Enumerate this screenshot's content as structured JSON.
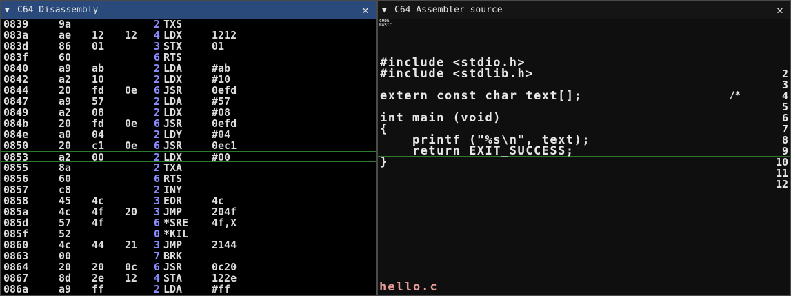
{
  "left_window": {
    "title": "C64 Disassembly",
    "collapse_glyph": "▼",
    "close_glyph": "✕",
    "rows": [
      {
        "addr": "0839",
        "b1": "9a",
        "b2": "",
        "b3": "",
        "cyc": "2",
        "mn": "TXS",
        "op": ""
      },
      {
        "addr": "083a",
        "b1": "ae",
        "b2": "12",
        "b3": "12",
        "cyc": "4",
        "mn": "LDX",
        "op": "1212"
      },
      {
        "addr": "083d",
        "b1": "86",
        "b2": "01",
        "b3": "",
        "cyc": "3",
        "mn": "STX",
        "op": "01"
      },
      {
        "addr": "083f",
        "b1": "60",
        "b2": "",
        "b3": "",
        "cyc": "6",
        "mn": "RTS",
        "op": ""
      },
      {
        "addr": "0840",
        "b1": "a9",
        "b2": "ab",
        "b3": "",
        "cyc": "2",
        "mn": "LDA",
        "op": "#ab"
      },
      {
        "addr": "0842",
        "b1": "a2",
        "b2": "10",
        "b3": "",
        "cyc": "2",
        "mn": "LDX",
        "op": "#10"
      },
      {
        "addr": "0844",
        "b1": "20",
        "b2": "fd",
        "b3": "0e",
        "cyc": "6",
        "mn": "JSR",
        "op": "0efd"
      },
      {
        "addr": "0847",
        "b1": "a9",
        "b2": "57",
        "b3": "",
        "cyc": "2",
        "mn": "LDA",
        "op": "#57"
      },
      {
        "addr": "0849",
        "b1": "a2",
        "b2": "08",
        "b3": "",
        "cyc": "2",
        "mn": "LDX",
        "op": "#08"
      },
      {
        "addr": "084b",
        "b1": "20",
        "b2": "fd",
        "b3": "0e",
        "cyc": "6",
        "mn": "JSR",
        "op": "0efd"
      },
      {
        "addr": "084e",
        "b1": "a0",
        "b2": "04",
        "b3": "",
        "cyc": "2",
        "mn": "LDY",
        "op": "#04"
      },
      {
        "addr": "0850",
        "b1": "20",
        "b2": "c1",
        "b3": "0e",
        "cyc": "6",
        "mn": "JSR",
        "op": "0ec1"
      },
      {
        "addr": "0853",
        "b1": "a2",
        "b2": "00",
        "b3": "",
        "cyc": "2",
        "mn": "LDX",
        "op": "#00"
      },
      {
        "addr": "0855",
        "b1": "8a",
        "b2": "",
        "b3": "",
        "cyc": "2",
        "mn": "TXA",
        "op": ""
      },
      {
        "addr": "0856",
        "b1": "60",
        "b2": "",
        "b3": "",
        "cyc": "6",
        "mn": "RTS",
        "op": ""
      },
      {
        "addr": "0857",
        "b1": "c8",
        "b2": "",
        "b3": "",
        "cyc": "2",
        "mn": "INY",
        "op": ""
      },
      {
        "addr": "0858",
        "b1": "45",
        "b2": "4c",
        "b3": "",
        "cyc": "3",
        "mn": "EOR",
        "op": "4c"
      },
      {
        "addr": "085a",
        "b1": "4c",
        "b2": "4f",
        "b3": "20",
        "cyc": "3",
        "mn": "JMP",
        "op": "204f"
      },
      {
        "addr": "085d",
        "b1": "57",
        "b2": "4f",
        "b3": "",
        "cyc": "6",
        "mn": "*SRE",
        "op": "4f,X"
      },
      {
        "addr": "085f",
        "b1": "52",
        "b2": "",
        "b3": "",
        "cyc": "0",
        "mn": "*KIL",
        "op": ""
      },
      {
        "addr": "0860",
        "b1": "4c",
        "b2": "44",
        "b3": "21",
        "cyc": "3",
        "mn": "JMP",
        "op": "2144"
      },
      {
        "addr": "0863",
        "b1": "00",
        "b2": "",
        "b3": "",
        "cyc": "7",
        "mn": "BRK",
        "op": ""
      },
      {
        "addr": "0864",
        "b1": "20",
        "b2": "20",
        "b3": "0c",
        "cyc": "6",
        "mn": "JSR",
        "op": "0c20"
      },
      {
        "addr": "0867",
        "b1": "8d",
        "b2": "2e",
        "b3": "12",
        "cyc": "4",
        "mn": "STA",
        "op": "122e"
      },
      {
        "addr": "086a",
        "b1": "a9",
        "b2": "ff",
        "b3": "",
        "cyc": "2",
        "mn": "LDA",
        "op": "#ff"
      }
    ],
    "selected_row": 12
  },
  "right_window": {
    "title": "C64 Assembler source",
    "collapse_glyph": "▼",
    "close_glyph": "✕",
    "mode_labels": [
      "CODE",
      "BASIC"
    ],
    "lines": [
      {
        "text": "#include <stdio.h>",
        "num": ""
      },
      {
        "text": "#include <stdlib.h>",
        "num": "2"
      },
      {
        "text": "",
        "num": "3"
      },
      {
        "text": "extern const char text[];",
        "num": "4"
      },
      {
        "text": "",
        "num": "5"
      },
      {
        "text": "int main (void)",
        "num": "6"
      },
      {
        "text": "{",
        "num": "7"
      },
      {
        "text": "    printf (\"%s\\n\", text);",
        "num": "8"
      },
      {
        "text": "    return EXIT_SUCCESS;",
        "num": "9"
      },
      {
        "text": "}",
        "num": "10"
      },
      {
        "text": "",
        "num": "11"
      },
      {
        "text": "",
        "num": "12"
      }
    ],
    "comment_mark": "/*",
    "selected_line": 8,
    "filename": "hello.c"
  },
  "colors": {
    "title_active": "#294a7a",
    "selection_border": "#2d7a2d",
    "cycle_count": "#8a8cff",
    "filename": "#e89a9a"
  }
}
